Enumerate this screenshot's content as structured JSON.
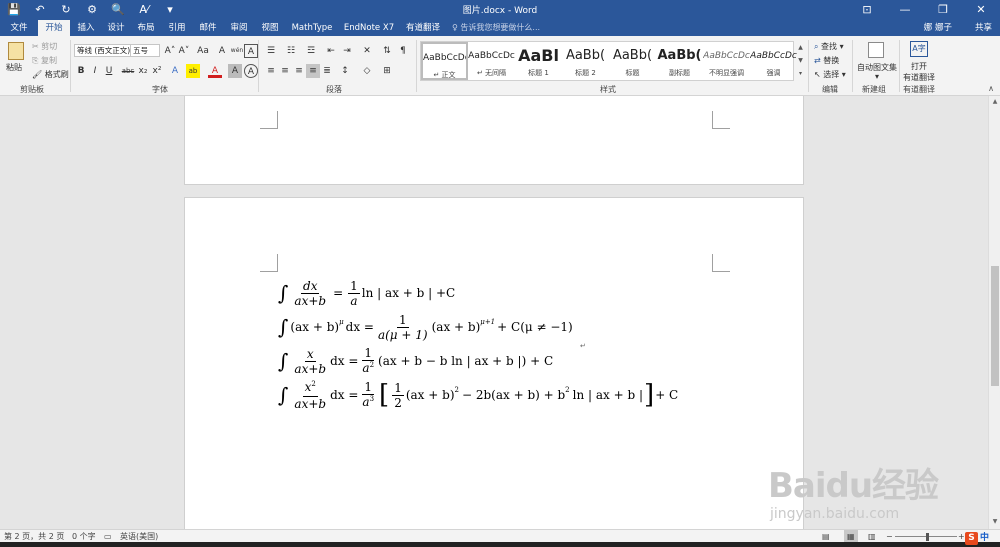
{
  "window": {
    "title": "图片.docx - Word",
    "user": "娜 娜子",
    "share": "共享",
    "controls": {
      "restore_ribbon": "⊡",
      "minimize": "—",
      "maximize": "❐",
      "close": "✕"
    }
  },
  "qat": {
    "save": "💾",
    "undo": "↶",
    "redo": "↻",
    "custom1": "⚙",
    "preview": "🔍",
    "spell": "A⁄",
    "more": "▾"
  },
  "tabs": [
    {
      "label": "文件",
      "active": false
    },
    {
      "label": "开始",
      "active": true
    },
    {
      "label": "插入",
      "active": false
    },
    {
      "label": "设计",
      "active": false
    },
    {
      "label": "布局",
      "active": false
    },
    {
      "label": "引用",
      "active": false
    },
    {
      "label": "邮件",
      "active": false
    },
    {
      "label": "审阅",
      "active": false
    },
    {
      "label": "视图",
      "active": false
    },
    {
      "label": "MathType",
      "active": false
    },
    {
      "label": "EndNote X7",
      "active": false
    },
    {
      "label": "有道翻译",
      "active": false
    }
  ],
  "tell_me": {
    "icon": "♀",
    "placeholder": "告诉我您想要做什么..."
  },
  "ribbon": {
    "clipboard": {
      "paste": "粘贴",
      "cut": "剪切",
      "copy": "复制",
      "format_painter": "格式刷",
      "label": "剪贴板"
    },
    "font": {
      "font_name": "等线 (西文正文)",
      "font_size": "五号",
      "grow": "A˄",
      "shrink": "A˅",
      "case": "Aa",
      "clear": "A",
      "phonetic": "wén",
      "border": "A",
      "bold": "B",
      "italic": "I",
      "underline": "U",
      "strike": "abc",
      "sub": "x₂",
      "sup": "x²",
      "effects": "A",
      "highlight": "ab",
      "color": "A",
      "shade": "A",
      "enclose": "A",
      "label": "字体"
    },
    "paragraph": {
      "label": "段落"
    },
    "styles": {
      "label": "样式",
      "items": [
        {
          "preview": "AaBbCcDc",
          "name": "↵ 正文",
          "selected": true,
          "font_size": "9px",
          "bold": false
        },
        {
          "preview": "AaBbCcDc",
          "name": "↵ 无间隔",
          "selected": false,
          "font_size": "9px",
          "bold": false
        },
        {
          "preview": "AaBl",
          "name": "标题 1",
          "selected": false,
          "font_size": "16px",
          "bold": true
        },
        {
          "preview": "AaBb(",
          "name": "标题 2",
          "selected": false,
          "font_size": "13px",
          "bold": false
        },
        {
          "preview": "AaBb(",
          "name": "标题",
          "selected": false,
          "font_size": "13px",
          "bold": false
        },
        {
          "preview": "AaBb(",
          "name": "副标题",
          "selected": false,
          "font_size": "13px",
          "bold": true
        },
        {
          "preview": "AaBbCcDc",
          "name": "不明显强调",
          "selected": false,
          "font_size": "9px",
          "bold": false
        },
        {
          "preview": "AaBbCcDc",
          "name": "强调",
          "selected": false,
          "font_size": "9px",
          "bold": false
        }
      ]
    },
    "editing": {
      "find": "查找",
      "replace": "替换",
      "select": "选择",
      "label": "编辑"
    },
    "new_group": {
      "auto_doc": "自动图文集",
      "label": "新建组"
    },
    "youdao": {
      "open": "打开",
      "translate": "有道翻译",
      "label": "有道翻译"
    }
  },
  "equations": {
    "eq1": {
      "num": "dx",
      "den": "ax+b",
      "eq": "=",
      "coef_num": "1",
      "coef_den": "a",
      "rest": "ln | ax + b | +C"
    },
    "eq2": {
      "base": "(ax + b)",
      "exp1": "μ",
      "tail": "dx =",
      "coef_num": "1",
      "coef_den": "a(μ + 1)",
      "base2": "(ax + b)",
      "exp2": "μ+1",
      "rest": "+ C(μ ≠ −1)"
    },
    "eq3": {
      "num": "x",
      "den": "ax+b",
      "dx": "dx =",
      "coef_num": "1",
      "coef_den": "a",
      "den_exp": "2",
      "rest": "(ax + b − b ln | ax + b |) + C"
    },
    "eq4": {
      "num": "x",
      "num_exp": "2",
      "den": "ax+b",
      "dx": "dx =",
      "coef_num": "1",
      "coef_den": "a",
      "den_exp": "3",
      "inner_num": "1",
      "inner_den": "2",
      "t1": "(ax + b)",
      "t1_exp": "2",
      "t2": "− 2b(ax + b) + b",
      "t2_exp": "2",
      "t3": "ln | ax + b |",
      "rest": "+ C"
    }
  },
  "status": {
    "page": "第 2 页，共 2 页",
    "words": "0 个字",
    "lang": "英语(美国)"
  },
  "watermark": {
    "text": "Baidu经验",
    "sub": "jingyan.baidu.com"
  },
  "ime": {
    "s": "S",
    "z": "中"
  }
}
